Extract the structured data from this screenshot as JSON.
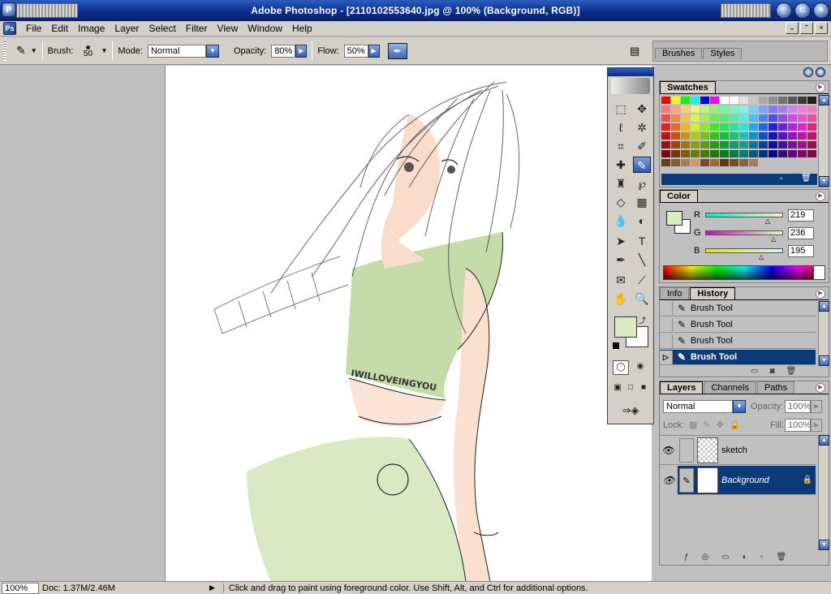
{
  "window": {
    "title": "Adobe Photoshop - [2110102553640.jpg @ 100% (Background, RGB)]"
  },
  "menu": {
    "items": [
      "File",
      "Edit",
      "Image",
      "Layer",
      "Select",
      "Filter",
      "View",
      "Window",
      "Help"
    ]
  },
  "options": {
    "brush_label": "Brush:",
    "brush_size": "50",
    "mode_label": "Mode:",
    "mode_value": "Normal",
    "opacity_label": "Opacity:",
    "opacity_value": "80%",
    "flow_label": "Flow:",
    "flow_value": "50%"
  },
  "palette_well": {
    "tabs": [
      "Brushes",
      "Styles"
    ]
  },
  "canvas": {
    "shirt_text": "IWILLOVEINGYOU"
  },
  "swatches": {
    "title": "Swatches"
  },
  "color": {
    "title": "Color",
    "r_label": "R",
    "r_value": "219",
    "g_label": "G",
    "g_value": "236",
    "b_label": "B",
    "b_value": "195",
    "foreground": "#dbecc3"
  },
  "history": {
    "tabs": [
      "Info",
      "History"
    ],
    "items": [
      "Brush Tool",
      "Brush Tool",
      "Brush Tool",
      "Brush Tool"
    ]
  },
  "layers": {
    "tabs": [
      "Layers",
      "Channels",
      "Paths"
    ],
    "blend_mode": "Normal",
    "opacity_label": "Opacity:",
    "opacity_value": "100%",
    "lock_label": "Lock:",
    "fill_label": "Fill:",
    "fill_value": "100%",
    "items": [
      {
        "name": "sketch",
        "selected": false
      },
      {
        "name": "Background",
        "selected": true
      }
    ]
  },
  "status": {
    "zoom": "100%",
    "doc": "Doc: 1.37M/2.46M",
    "hint": "Click and drag to paint using foreground color.  Use Shift, Alt, and Ctrl for additional options."
  },
  "colors": {
    "accent": "#0a2c8a",
    "selection": "#0a3a7a"
  }
}
